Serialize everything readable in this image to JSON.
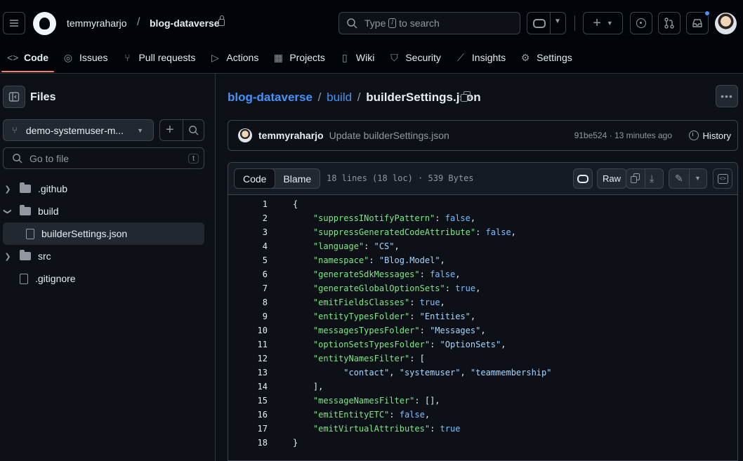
{
  "header": {
    "owner": "temmyraharjo",
    "separator": "/",
    "repo": "blog-dataverse",
    "search_placeholder_before": "Type",
    "search_key": "/",
    "search_placeholder_after": "to search",
    "icons": [
      "hamburger-icon",
      "github-logo",
      "search-icon",
      "copilot-icon",
      "plus-icon",
      "issue-icon",
      "pull-request-icon",
      "inbox-icon"
    ]
  },
  "tabs": [
    {
      "label": "Code",
      "icon": "code-icon"
    },
    {
      "label": "Issues",
      "icon": "issue-icon"
    },
    {
      "label": "Pull requests",
      "icon": "pull-request-icon"
    },
    {
      "label": "Actions",
      "icon": "play-icon"
    },
    {
      "label": "Projects",
      "icon": "table-icon"
    },
    {
      "label": "Wiki",
      "icon": "book-icon"
    },
    {
      "label": "Security",
      "icon": "shield-icon"
    },
    {
      "label": "Insights",
      "icon": "graph-icon"
    },
    {
      "label": "Settings",
      "icon": "gear-icon"
    }
  ],
  "sidebar": {
    "title": "Files",
    "branch": "demo-systemuser-m...",
    "goto_placeholder": "Go to file",
    "goto_key": "t",
    "tree": [
      {
        "label": ".github",
        "type": "folder",
        "expanded": false
      },
      {
        "label": "build",
        "type": "folder",
        "expanded": true
      },
      {
        "label": "builderSettings.json",
        "type": "file",
        "selected": true
      },
      {
        "label": "src",
        "type": "folder",
        "expanded": false
      },
      {
        "label": ".gitignore",
        "type": "file"
      }
    ]
  },
  "breadcrumb": {
    "repo": "blog-dataverse",
    "sep": "/",
    "folder": "build",
    "file": "builderSettings.json"
  },
  "commit": {
    "author": "temmyraharjo",
    "message": "Update builderSettings.json",
    "sha_time": "91be524 · 13 minutes ago",
    "history": "History"
  },
  "file": {
    "tab_code": "Code",
    "tab_blame": "Blame",
    "meta": "18 lines (18 loc) · 539 Bytes",
    "raw": "Raw"
  },
  "code_lines": [
    "1",
    "2",
    "3",
    "4",
    "5",
    "6",
    "7",
    "8",
    "9",
    "10",
    "11",
    "12",
    "13",
    "14",
    "15",
    "16",
    "17",
    "18"
  ],
  "code": {
    "l1": "{",
    "l2k": "\"suppressINotifyPattern\"",
    "l2v": "false",
    "l3k": "\"suppressGeneratedCodeAttribute\"",
    "l3v": "false",
    "l4k": "\"language\"",
    "l4v": "\"CS\"",
    "l5k": "\"namespace\"",
    "l5v": "\"Blog.Model\"",
    "l6k": "\"generateSdkMessages\"",
    "l6v": "false",
    "l7k": "\"generateGlobalOptionSets\"",
    "l7v": "true",
    "l8k": "\"emitFieldsClasses\"",
    "l8v": "true",
    "l9k": "\"entityTypesFolder\"",
    "l9v": "\"Entities\"",
    "l10k": "\"messagesTypesFolder\"",
    "l10v": "\"Messages\"",
    "l11k": "\"optionSetsTypesFolder\"",
    "l11v": "\"OptionSets\"",
    "l12k": "\"entityNamesFilter\"",
    "l12v": "[",
    "l13a": "\"contact\"",
    "l13b": "\"systemuser\"",
    "l13c": "\"teammembership\"",
    "l14": "],",
    "l15k": "\"messageNamesFilter\"",
    "l15v": "[],",
    "l16k": "\"emitEntityETC\"",
    "l16v": "false",
    "l17k": "\"emitVirtualAttributes\"",
    "l17v": "true",
    "l18": "}"
  },
  "colors": {
    "accent": "#f78166",
    "link": "#4493f8",
    "key": "#7ee787",
    "string": "#a5d6ff",
    "bool": "#79c0ff"
  }
}
